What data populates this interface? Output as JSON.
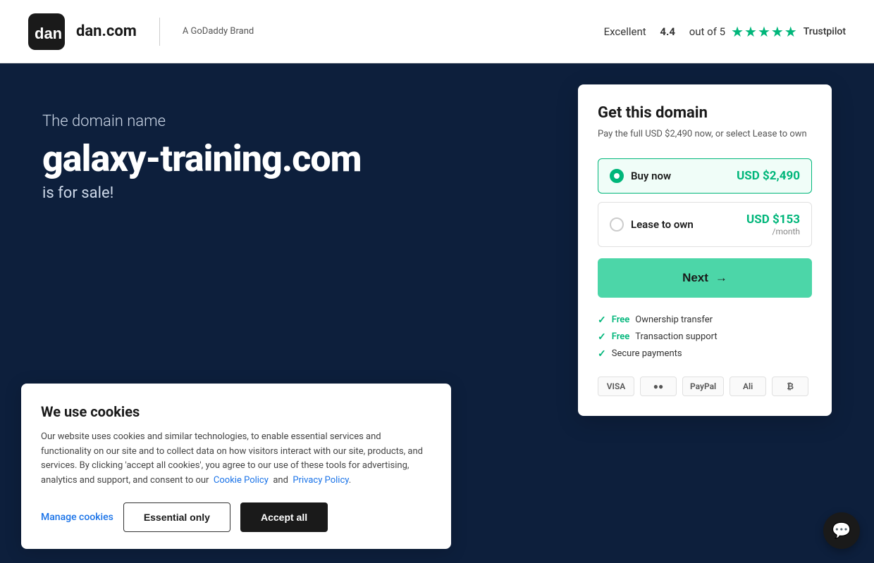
{
  "header": {
    "logo_text": "dan.com",
    "brand_label": "A GoDaddy Brand",
    "trustpilot": {
      "prefix": "Excellent",
      "score": "4.4",
      "suffix": "out of 5",
      "label": "Trustpilot"
    }
  },
  "hero": {
    "subtitle": "The domain name",
    "domain": "galaxy-training.com",
    "sale_text": "is for sale!"
  },
  "domain_card": {
    "title": "Get this domain",
    "subtitle": "Pay the full USD $2,490 now, or select Lease to own",
    "options": [
      {
        "label": "Buy now",
        "price": "USD $2,490",
        "sub_price": "",
        "selected": true
      },
      {
        "label": "Lease to own",
        "price": "USD $153",
        "sub_price": "/month",
        "selected": false
      }
    ],
    "next_button": "Next",
    "features": [
      {
        "prefix": "Free",
        "text": "Ownership transfer"
      },
      {
        "prefix": "Free",
        "text": "Transaction support"
      },
      {
        "prefix": "",
        "text": "Secure payments"
      }
    ],
    "payments": [
      "VISA",
      "MC",
      "PayPal",
      "Alipay",
      "BTC"
    ]
  },
  "cookie_banner": {
    "title": "We use cookies",
    "body": "Our website uses cookies and similar technologies, to enable essential services and functionality on our site and to collect data on how visitors interact with our site, products, and services. By clicking 'accept all cookies', you agree to our use of these tools for advertising, analytics and support, and consent to our",
    "cookie_policy_link": "Cookie Policy",
    "and_text": "and",
    "privacy_policy_link": "Privacy Policy",
    "period": ".",
    "manage_label": "Manage cookies",
    "essential_label": "Essential only",
    "accept_label": "Accept all"
  },
  "chat": {
    "icon": "💬"
  }
}
